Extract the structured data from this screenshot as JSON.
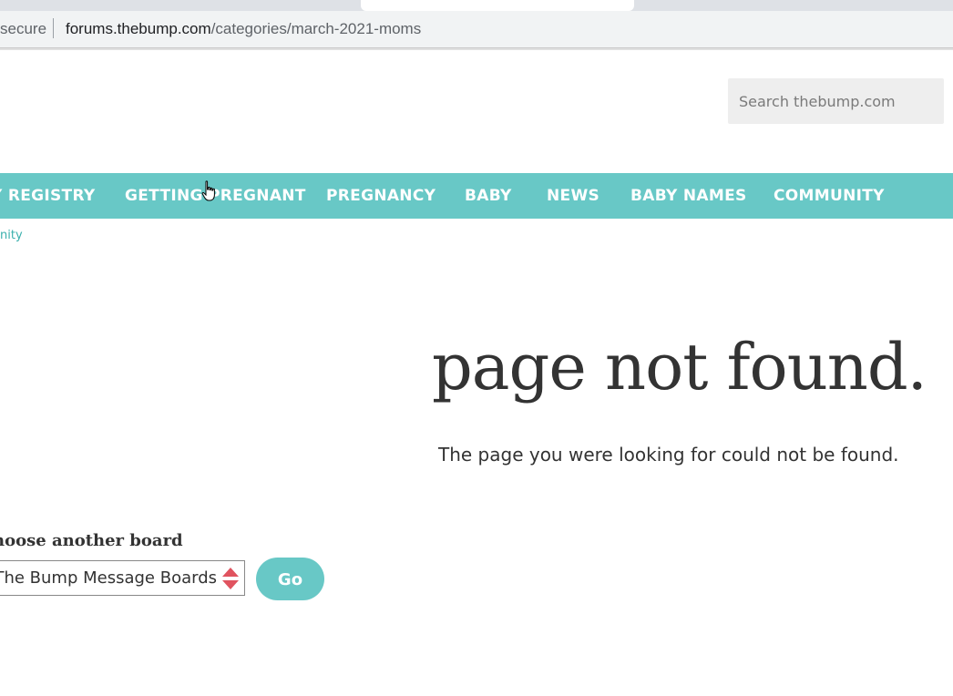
{
  "browser": {
    "address_secure_label": "secure",
    "url_host": "forums.thebump.com",
    "url_path": "/categories/march-2021-moms"
  },
  "search": {
    "placeholder": "Search thebump.com"
  },
  "nav": {
    "items": [
      {
        "label": "Y REGISTRY"
      },
      {
        "label": "GETTING PREGNANT"
      },
      {
        "label": "PREGNANCY"
      },
      {
        "label": "BABY"
      },
      {
        "label": "NEWS"
      },
      {
        "label": "BABY NAMES"
      },
      {
        "label": "COMMUNITY"
      }
    ],
    "color": "#68c8c6"
  },
  "breadcrumb": {
    "text": "nity"
  },
  "not_found": {
    "title": "page not found.",
    "message": "The page you were looking for could not be found."
  },
  "board_chooser": {
    "label": "hoose another board",
    "selected": "The Bump Message Boards",
    "go_label": "Go"
  },
  "colors": {
    "accent": "#68c8c6",
    "select_arrow": "#e0535f"
  }
}
